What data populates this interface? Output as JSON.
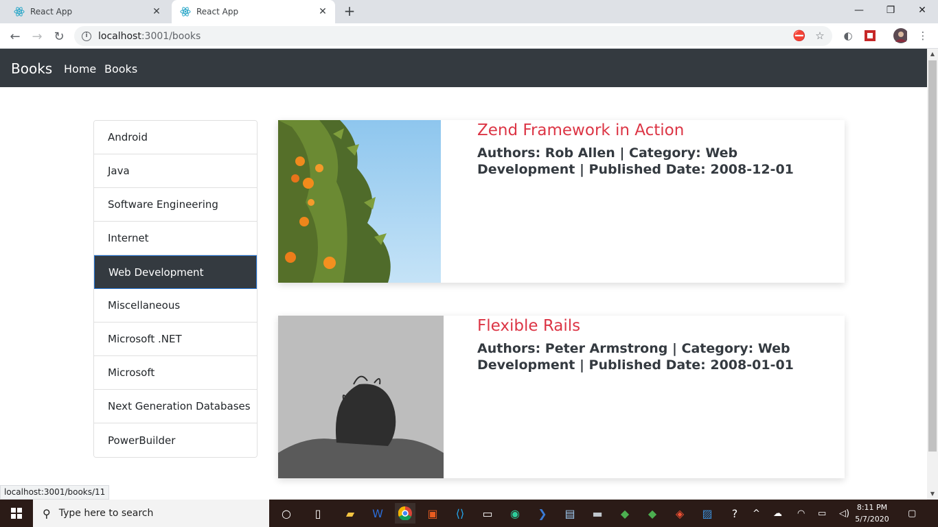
{
  "browser": {
    "tabs": [
      {
        "title": "React App",
        "active": false
      },
      {
        "title": "React App",
        "active": true
      }
    ],
    "url_host": "localhost",
    "url_path": ":3001/books",
    "status_url": "localhost:3001/books/11"
  },
  "navbar": {
    "brand": "Books",
    "links": [
      "Home",
      "Books"
    ]
  },
  "categories": {
    "items": [
      "Android",
      "Java",
      "Software Engineering",
      "Internet",
      "Web Development",
      "Miscellaneous",
      "Microsoft .NET",
      "Microsoft",
      "Next Generation Databases",
      "PowerBuilder"
    ],
    "active_index": 4
  },
  "books": [
    {
      "title": "Zend Framework in Action",
      "meta": "Authors: Rob Allen | Category: Web Development | Published Date: 2008-12-01"
    },
    {
      "title": "Flexible Rails",
      "meta": "Authors: Peter Armstrong | Category: Web Development | Published Date: 2008-01-01"
    }
  ],
  "taskbar": {
    "search_placeholder": "Type here to search",
    "time": "8:11 PM",
    "date": "5/7/2020"
  },
  "colors": {
    "navbar_bg": "#343a40",
    "book_title": "#dc3545",
    "active_category_bg": "#343a40"
  }
}
